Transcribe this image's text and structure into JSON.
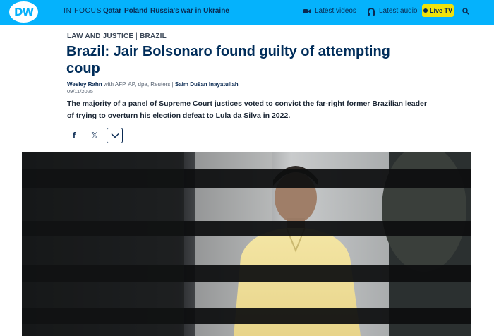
{
  "header": {
    "logo": "DW",
    "in_focus": "IN FOCUS",
    "topics": [
      "Qatar",
      "Poland",
      "Russia's war in Ukraine"
    ],
    "latest_videos": "Latest videos",
    "latest_audio": "Latest audio",
    "live_tv": "Live TV",
    "colors": {
      "bar": "#05b2fc",
      "live_tv": "#f0e20a",
      "text": "#0a2a52"
    }
  },
  "article": {
    "kicker_1": "LAW AND JUSTICE",
    "kicker_sep": "|",
    "kicker_2": "BRAZIL",
    "headline": "Brazil: Jair Bolsonaro found guilty of attempting coup",
    "author": "Wesley Rahn",
    "with_text": "with AFP, AP, dpa, Reuters",
    "byline_sep": "|",
    "editor": "Saim Dušan Inayatullah",
    "date": "09/11/2025",
    "teaser": "The majority of a panel of Supreme Court justices voted to convict the far-right former Brazilian leader of trying to overturn his election defeat to Lula da Silva in 2022."
  },
  "share": {
    "facebook_icon": "f",
    "x_icon": "𝕏",
    "more_icon": "chevron-down-icon"
  }
}
